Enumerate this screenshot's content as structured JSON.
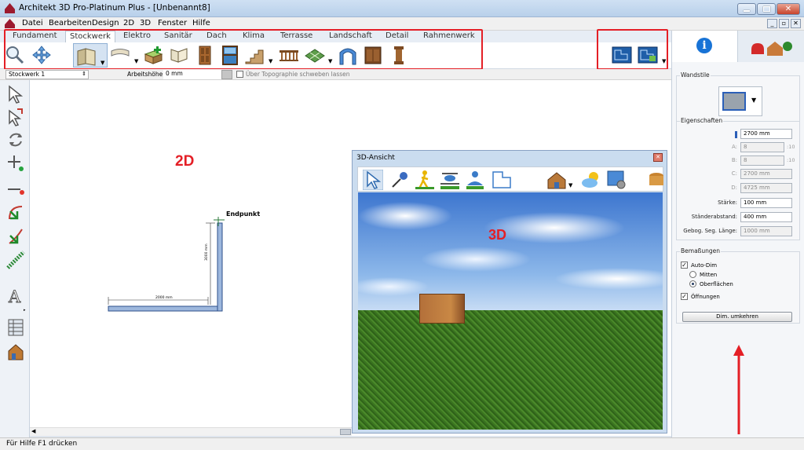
{
  "window": {
    "title": "Architekt 3D Pro-Platinum Plus - [Unbenannt8]"
  },
  "menu": [
    "Datei",
    "Bearbeiten",
    "Design",
    "2D",
    "3D",
    "Fenster",
    "Hilfe"
  ],
  "tabs": [
    "Fundament",
    "Stockwerk",
    "Elektro",
    "Sanitär",
    "Dach",
    "Klima",
    "Terrasse",
    "Landschaft",
    "Detail",
    "Rahmenwerk"
  ],
  "active_tab": "Stockwerk",
  "options_bar": {
    "floor": "Stockwerk 1",
    "work_height_label": "Arbeitshöhe:",
    "work_height_value": "0 mm",
    "topography_label": "Über Topographie schweben lassen"
  },
  "canvas2d": {
    "label": "2D",
    "endpoint_label": "Endpunkt",
    "dim_horizontal": "2000 mm",
    "dim_vertical": "3000 mm"
  },
  "view3d": {
    "window_title": "3D-Ansicht",
    "label": "3D"
  },
  "right_panel": {
    "wall_styles_label": "Wandstile",
    "properties_label": "Eigenschaften",
    "height_value": "2700 mm",
    "a_label": "A:",
    "a_value": "8",
    "a_unit": ":10",
    "b_label": "B:",
    "b_value": "8",
    "b_unit": ":10",
    "c_label": "C:",
    "c_value": "2700 mm",
    "d_label": "D:",
    "d_value": "4725 mm",
    "thickness_label": "Stärke:",
    "thickness_value": "100 mm",
    "stud_label": "Ständerabstand:",
    "stud_value": "400 mm",
    "seg_label": "Gebog. Seg. Länge:",
    "seg_value": "1000 mm",
    "dims_label": "Bemaßungen",
    "auto_dim": "Auto-Dim",
    "centers": "Mitten",
    "surfaces": "Oberflächen",
    "openings": "Öffnungen",
    "reverse_button": "Dim. umkehren"
  },
  "status_text": "Für Hilfe F1 drücken",
  "colors": {
    "annotation_red": "#e41f26",
    "wall_blue": "#9db7dd",
    "sky": "#4f87d8",
    "grass": "#3f7a22",
    "box": "#b3703a"
  }
}
